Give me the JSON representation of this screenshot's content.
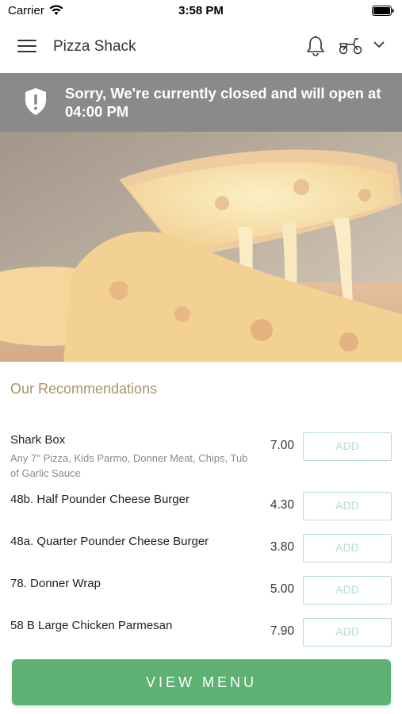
{
  "status_bar": {
    "carrier": "Carrier",
    "time": "3:58 PM"
  },
  "header": {
    "title": "Pizza Shack",
    "icons": [
      "menu-icon",
      "bell-icon",
      "scooter-icon",
      "chevron-down-icon"
    ]
  },
  "banner": {
    "message": "Sorry, We're currently closed and will open at 04:00 PM",
    "icon": "shield-alert-icon",
    "background": "#8a8a8a"
  },
  "hero": {
    "image": "cheese-pizza-slice-photo"
  },
  "recommendations": {
    "title": "Our Recommendations",
    "add_label": "ADD",
    "items": [
      {
        "name": "Shark Box",
        "description": "Any 7\" Pizza, Kids Parmo, Donner Meat, Chips, Tub of Garlic Sauce",
        "price": "7.00"
      },
      {
        "name": "48b. Half Pounder Cheese Burger",
        "description": "",
        "price": "4.30"
      },
      {
        "name": "48a. Quarter Pounder Cheese Burger",
        "description": "",
        "price": "3.80"
      },
      {
        "name": "78. Donner Wrap",
        "description": "",
        "price": "5.00"
      },
      {
        "name": "58 B Large Chicken Parmesan",
        "description": "",
        "price": "7.90"
      }
    ]
  },
  "footer": {
    "view_menu_label": "VIEW MENU",
    "accent": "#5fb073"
  },
  "colors": {
    "section_title": "#a6946a",
    "add_button": "#b5dfc7"
  }
}
